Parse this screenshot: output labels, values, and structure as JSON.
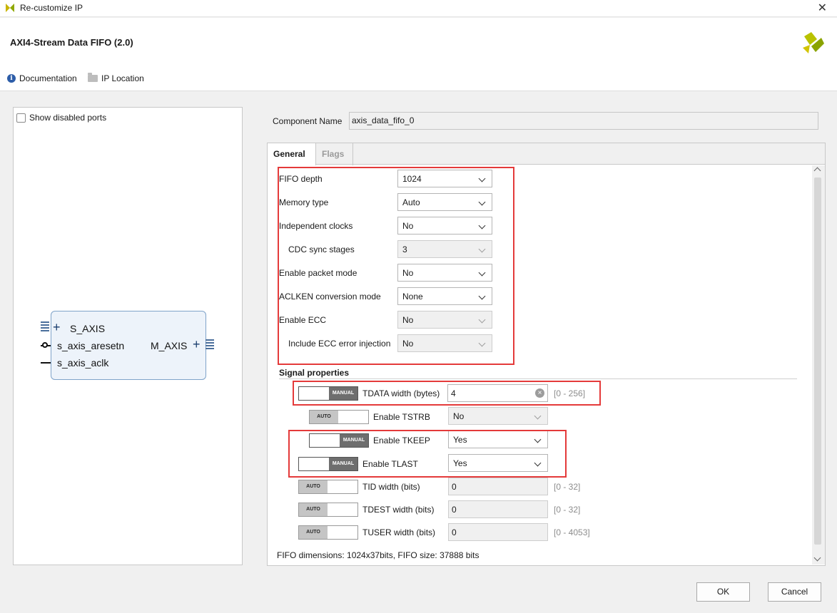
{
  "window": {
    "title": "Re-customize IP"
  },
  "header": {
    "ip_title": "AXI4-Stream Data FIFO (2.0)",
    "documentation": "Documentation",
    "ip_location": "IP Location"
  },
  "symbol_panel": {
    "show_disabled_ports": "Show disabled ports",
    "ports": {
      "s_axis": "S_AXIS",
      "s_axis_aresetn": "s_axis_aresetn",
      "s_axis_aclk": "s_axis_aclk",
      "m_axis": "M_AXIS"
    }
  },
  "component": {
    "label": "Component Name",
    "value": "axis_data_fifo_0"
  },
  "tabs": [
    {
      "label": "General",
      "active": true
    },
    {
      "label": "Flags",
      "active": false
    }
  ],
  "general": {
    "fifo_depth": {
      "label": "FIFO depth",
      "value": "1024"
    },
    "memory_type": {
      "label": "Memory type",
      "value": "Auto"
    },
    "independent_clocks": {
      "label": "Independent clocks",
      "value": "No"
    },
    "cdc_sync_stages": {
      "label": "CDC sync stages",
      "value": "3"
    },
    "packet_mode": {
      "label": "Enable packet mode",
      "value": "No"
    },
    "aclken_mode": {
      "label": "ACLKEN conversion mode",
      "value": "None"
    },
    "enable_ecc": {
      "label": "Enable ECC",
      "value": "No"
    },
    "ecc_injection": {
      "label": "Include ECC error injection",
      "value": "No"
    }
  },
  "signal_properties": {
    "title": "Signal properties",
    "manual_text": "MANUAL",
    "auto_text": "AUTO",
    "tdata": {
      "label": "TDATA width (bytes)",
      "value": "4",
      "range": "[0 - 256]",
      "mode": "MANUAL"
    },
    "tstrb": {
      "label": "Enable TSTRB",
      "value": "No",
      "mode": "AUTO"
    },
    "tkeep": {
      "label": "Enable TKEEP",
      "value": "Yes",
      "mode": "MANUAL"
    },
    "tlast": {
      "label": "Enable TLAST",
      "value": "Yes",
      "mode": "MANUAL"
    },
    "tid": {
      "label": "TID width (bits)",
      "value": "0",
      "range": "[0 - 32]",
      "mode": "AUTO"
    },
    "tdest": {
      "label": "TDEST width (bits)",
      "value": "0",
      "range": "[0 - 32]",
      "mode": "AUTO"
    },
    "tuser": {
      "label": "TUSER width (bits)",
      "value": "0",
      "range": "[0 - 4053]",
      "mode": "AUTO"
    }
  },
  "summary": "FIFO dimensions: 1024x37bits, FIFO size: 37888 bits",
  "buttons": {
    "ok": "OK",
    "cancel": "Cancel"
  },
  "colors": {
    "highlight": "#e43a3a",
    "symbol_fill": "#edf3fa",
    "info": "#2d5da8"
  }
}
